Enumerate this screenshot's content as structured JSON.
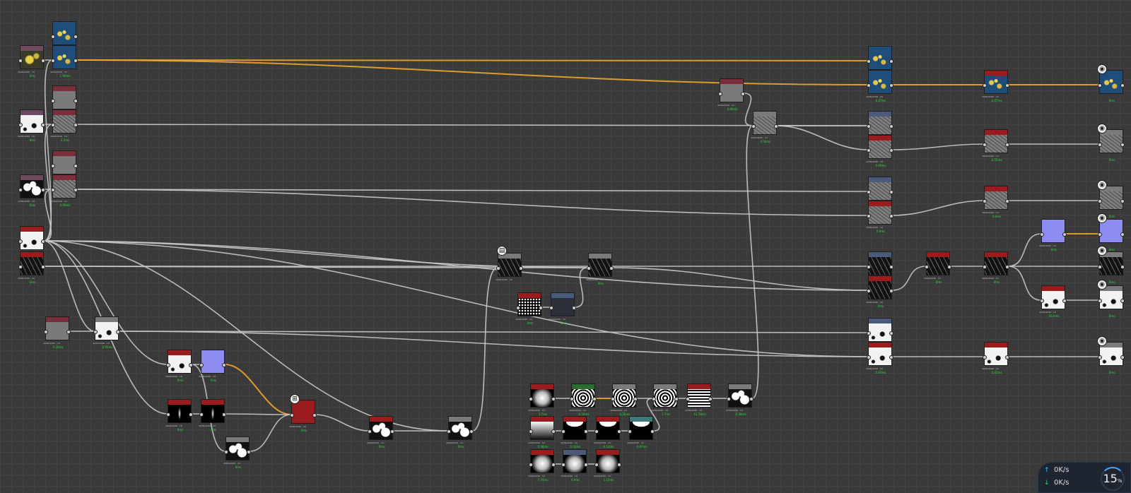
{
  "colors": {
    "link": "#c9c9c9",
    "link_orange": "#f0a62d",
    "time": "#2ede3b"
  },
  "nodes": [
    {
      "id": "a1",
      "header": "#6e4a5e",
      "tex": "yellow",
      "cap": "4096x4096 · 16",
      "time": "0ms"
    },
    {
      "id": "a2",
      "header": "#1f4d7a",
      "tex": "blue",
      "cap": "",
      "time": ""
    },
    {
      "id": "a3",
      "header": "#1f4d7a",
      "tex": "blue",
      "cap": "4096x4096 · 16",
      "time": "1.90ms"
    },
    {
      "id": "b1",
      "header": "#6e4a5e",
      "tex": "white",
      "cap": "4096x4096 · 16",
      "time": "0ms"
    },
    {
      "id": "b2",
      "header": "#7a2e3a",
      "tex": "gray",
      "cap": "",
      "time": ""
    },
    {
      "id": "b3",
      "header": "#7a2e3a",
      "tex": "noise",
      "cap": "4096x4096 · 16",
      "time": "2.1ms"
    },
    {
      "id": "c1",
      "header": "#6e4a5e",
      "tex": "bw",
      "cap": "4096x4096 · 16",
      "time": "0ms"
    },
    {
      "id": "c2",
      "header": "#7a2e3a",
      "tex": "gray",
      "cap": "",
      "time": ""
    },
    {
      "id": "c3",
      "header": "#7a2e3a",
      "tex": "noise",
      "cap": "4096x4096 · 16",
      "time": "0.90ms"
    },
    {
      "id": "d1",
      "header": "#9b1c1c",
      "tex": "white",
      "cap": "",
      "time": ""
    },
    {
      "id": "d2",
      "header": "#9b1c1c",
      "tex": "black",
      "cap": "4096x4096 · 16",
      "time": "0ms"
    },
    {
      "id": "e1",
      "header": "#7a2e3a",
      "tex": "gray",
      "cap": "4096x4096 · 16",
      "time": "0.34ms"
    },
    {
      "id": "e2",
      "header": "#7a7a7a",
      "tex": "white",
      "cap": "4096x4096 · 16",
      "time": "0.95ms"
    },
    {
      "id": "f1",
      "header": "#9b1c1c",
      "tex": "white",
      "cap": "4096x4096 · 16",
      "time": "0ms"
    },
    {
      "id": "f2",
      "header": "#8d8cf2",
      "tex": "purple",
      "cap": "4096x4096 · 16",
      "time": "0ms"
    },
    {
      "id": "g1",
      "header": "#9b1c1c",
      "tex": "streak",
      "cap": "4096x4096 · 16",
      "time": "0ms"
    },
    {
      "id": "g2",
      "header": "#9b1c1c",
      "tex": "streak",
      "cap": "4096x4096 · 16",
      "time": "0ms"
    },
    {
      "id": "g3",
      "header": "#7a7a7a",
      "tex": "bw",
      "cap": "4096x4096 · 16",
      "time": "0ms"
    },
    {
      "id": "blend",
      "header": "#9b1c1c",
      "tex": "red",
      "cap": "4096x4096 · 16",
      "time": "0ms"
    },
    {
      "id": "h1",
      "header": "#9b1c1c",
      "tex": "bw",
      "cap": "4096x4096 · 16",
      "time": "0ms"
    },
    {
      "id": "h2",
      "header": "#7a7a7a",
      "tex": "bw",
      "cap": "4096x4096 · 16",
      "time": "0ms"
    },
    {
      "id": "m1",
      "header": "#7a7a7a",
      "tex": "black",
      "cap": "4096x4096 · 16",
      "time": ""
    },
    {
      "id": "m2",
      "header": "#7a7a7a",
      "tex": "black",
      "cap": "4096x4096 · 16",
      "time": "0ms"
    },
    {
      "id": "m3",
      "header": "#9b1c1c",
      "tex": "dots",
      "cap": "4096x4096 · 16",
      "time": "0ms"
    },
    {
      "id": "m4",
      "header": "#4a5a7a",
      "tex": "dark",
      "cap": "4096x4096 · 16",
      "time": "0ms"
    },
    {
      "id": "s1",
      "header": "#9b1c1c",
      "tex": "sphere",
      "cap": "4096x4096 · 16",
      "time": "1.7ms"
    },
    {
      "id": "s2",
      "header": "#2e6b2e",
      "tex": "rings",
      "cap": "4096x4096 · 16",
      "time": "0.50ms"
    },
    {
      "id": "s3",
      "header": "#7a7a7a",
      "tex": "rings",
      "cap": "4096x4096 · 16",
      "time": "0.30ms"
    },
    {
      "id": "s4",
      "header": "#7a7a7a",
      "tex": "rings",
      "cap": "4096x4096 · 16",
      "time": "1.7ms"
    },
    {
      "id": "s5",
      "header": "#9b1c1c",
      "tex": "stripes",
      "cap": "4096x4096 · 16",
      "time": "12.78ms"
    },
    {
      "id": "s6",
      "header": "#7a7a7a",
      "tex": "bw",
      "cap": "4096x4096 · 16",
      "time": "0.38ms"
    },
    {
      "id": "t1",
      "header": "#9b1c1c",
      "tex": "grad",
      "cap": "4096x4096 · 16",
      "time": "0.46ms"
    },
    {
      "id": "t2",
      "header": "#9b1c1c",
      "tex": "curve",
      "cap": "4096x4096 · 16",
      "time": "0.43ms"
    },
    {
      "id": "t3",
      "header": "#9b1c1c",
      "tex": "curve",
      "cap": "4096x4096 · 16",
      "time": "0.14ms"
    },
    {
      "id": "t4",
      "header": "#3a7a7a",
      "tex": "curve",
      "cap": "4096x4096 · 16",
      "time": "0.87ms"
    },
    {
      "id": "u1",
      "header": "#9b1c1c",
      "tex": "sphere",
      "cap": "4096x4096 · 16",
      "time": "7.70ms"
    },
    {
      "id": "u2",
      "header": "#4a5a7a",
      "tex": "sphere",
      "cap": "4096x4096 · 16",
      "time": "4.9ms"
    },
    {
      "id": "u3",
      "header": "#9b1c1c",
      "tex": "sphere",
      "cap": "4096x4096 · 16",
      "time": "1.15ms"
    },
    {
      "id": "p1",
      "header": "#7a2e3a",
      "tex": "gray",
      "cap": "4096x4096 · 16",
      "time": "0.89ms"
    },
    {
      "id": "p2",
      "header": "#7a7a7a",
      "tex": "noise",
      "cap": "4096x4096 · 16",
      "time": "0.56ms"
    },
    {
      "id": "r1",
      "header": "#1f4d7a",
      "tex": "blue",
      "cap": "",
      "time": ""
    },
    {
      "id": "r2",
      "header": "#1f4d7a",
      "tex": "blue",
      "cap": "4096x4096 · 16",
      "time": "0.47ms"
    },
    {
      "id": "r3",
      "header": "#4a5a7a",
      "tex": "noise",
      "cap": "",
      "time": ""
    },
    {
      "id": "r4",
      "header": "#9b1c1c",
      "tex": "noise",
      "cap": "4096x4096 · 16",
      "time": "0.90ms"
    },
    {
      "id": "r5",
      "header": "#4a5a7a",
      "tex": "noise",
      "cap": "",
      "time": ""
    },
    {
      "id": "r6",
      "header": "#9b1c1c",
      "tex": "noise",
      "cap": "4096x4096 · 16",
      "time": "0.9ms"
    },
    {
      "id": "r7",
      "header": "#4a5a7a",
      "tex": "black",
      "cap": "",
      "time": ""
    },
    {
      "id": "r8",
      "header": "#9b1c1c",
      "tex": "black",
      "cap": "4096x4096 · 16",
      "time": "0ms"
    },
    {
      "id": "r9",
      "header": "#4a5a7a",
      "tex": "white",
      "cap": "",
      "time": ""
    },
    {
      "id": "r10",
      "header": "#9b1c1c",
      "tex": "white",
      "cap": "4096x4096 · 16",
      "time": "0.95ms"
    },
    {
      "id": "q1",
      "header": "#9b1c1c",
      "tex": "blue",
      "cap": "4096x4096 · 16",
      "time": "0.47ms"
    },
    {
      "id": "q2",
      "header": "#9b1c1c",
      "tex": "noise",
      "cap": "4096x4096 · 16",
      "time": "0.55ms"
    },
    {
      "id": "q3",
      "header": "#9b1c1c",
      "tex": "noise",
      "cap": "4096x4096 · 16",
      "time": "0.4ms"
    },
    {
      "id": "q4",
      "header": "#9b1c1c",
      "tex": "black",
      "cap": "4096x4096 · 16",
      "time": "0ms"
    },
    {
      "id": "q5",
      "header": "#9b1c1c",
      "tex": "black",
      "cap": "4096x4096 · 16",
      "time": "0ms"
    },
    {
      "id": "q6",
      "header": "#9b1c1c",
      "tex": "white",
      "cap": "4096x4096 · 16",
      "time": "0.42ms"
    },
    {
      "id": "o1",
      "header": "#1f4d7a",
      "tex": "blue",
      "cap": "",
      "time": "0ms"
    },
    {
      "id": "o2",
      "header": "#7a7a7a",
      "tex": "noise",
      "cap": "",
      "time": "0ms"
    },
    {
      "id": "o3",
      "header": "#7a7a7a",
      "tex": "noise",
      "cap": "",
      "time": "0ms"
    },
    {
      "id": "o4",
      "header": "#8d8cf2",
      "tex": "purple",
      "cap": "",
      "time": "0ms"
    },
    {
      "id": "o5",
      "header": "#7a7a7a",
      "tex": "black",
      "cap": "",
      "time": "0ms"
    },
    {
      "id": "o6",
      "header": "#7a7a7a",
      "tex": "white",
      "cap": "",
      "time": "0ms"
    },
    {
      "id": "o7",
      "header": "#7a7a7a",
      "tex": "white",
      "cap": "",
      "time": "0ms"
    },
    {
      "id": "n1",
      "header": "#8d8cf2",
      "tex": "purple",
      "cap": "4096x4096 · 16",
      "time": "0ms"
    },
    {
      "id": "n2",
      "header": "#9b1c1c",
      "tex": "white",
      "cap": "4096x4096 · 16",
      "time": "10.0ms"
    }
  ],
  "badges": [
    {
      "id": "bd1",
      "glyph": "◉"
    },
    {
      "id": "bd2",
      "glyph": "◉"
    },
    {
      "id": "bd3",
      "glyph": "◉"
    },
    {
      "id": "bd4",
      "glyph": "◉"
    },
    {
      "id": "bd5",
      "glyph": "◉"
    },
    {
      "id": "bd6",
      "glyph": "◉"
    },
    {
      "id": "bd7",
      "glyph": "◉"
    },
    {
      "id": "bd8",
      "glyph": "▤"
    },
    {
      "id": "bd9",
      "glyph": "⊞"
    }
  ],
  "net_widget": {
    "upload_icon": "arrow-up-icon",
    "download_icon": "arrow-down-icon",
    "upload": "0K/s",
    "download": "0K/s",
    "cpu_value": "15",
    "cpu_unit": "%"
  }
}
